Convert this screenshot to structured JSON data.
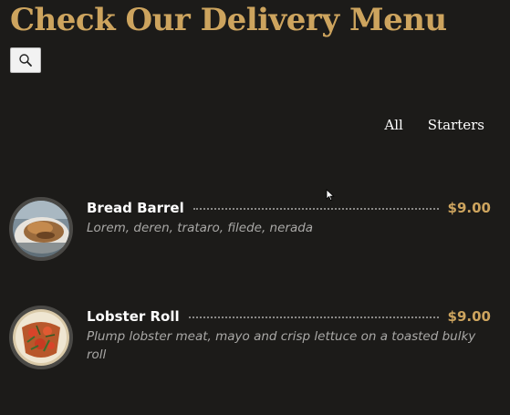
{
  "header": {
    "title": "Check Our Delivery Menu"
  },
  "search": {
    "icon": "search-icon"
  },
  "filters": [
    {
      "label": "All"
    },
    {
      "label": "Starters"
    }
  ],
  "menu": {
    "items": [
      {
        "name": "Bread Barrel",
        "price": "$9.00",
        "description": "Lorem, deren, trataro, filede, nerada",
        "image": "bread-barrel-photo"
      },
      {
        "name": "Lobster Roll",
        "price": "$9.00",
        "description": "Plump lobster meat, mayo and crisp lettuce on a toasted bulky roll",
        "image": "lobster-roll-photo"
      }
    ]
  },
  "colors": {
    "background": "#1c1b19",
    "accent": "#cda45e",
    "text": "#ffffff",
    "muted": "#a9a8a6"
  }
}
